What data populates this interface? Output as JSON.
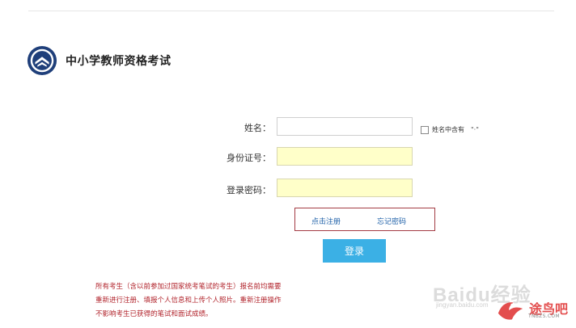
{
  "header": {
    "title": "中小学教师资格考试"
  },
  "form": {
    "name_label": "姓名：",
    "name_value": "",
    "name_dot_checkbox_label": "姓名中含有",
    "name_dot_checkbox_symbol": "\"·\"",
    "id_label": "身份证号：",
    "id_value": "",
    "password_label": "登录密码：",
    "password_value": ""
  },
  "links": {
    "register": "点击注册",
    "forgot_password": "忘记密码"
  },
  "login_button": "登录",
  "notice": {
    "line1": "所有考生（含以前参加过国家统考笔试的考生）报名前均需要",
    "line2": "重新进行注册、填报个人信息和上传个人照片。重新注册操作",
    "line3": "不影响考生已获得的笔试和面试成绩。"
  },
  "watermark": {
    "brand": "Baidu经验",
    "sub": "jingyan.baidu.com"
  },
  "stamp": {
    "text": "途鸟吧",
    "sub": "TNBZS.COM"
  },
  "colors": {
    "accent_blue": "#3bb0e5",
    "notice_red": "#b1232b",
    "link_blue": "#1e60a8",
    "input_yellow": "#ffffc9"
  }
}
